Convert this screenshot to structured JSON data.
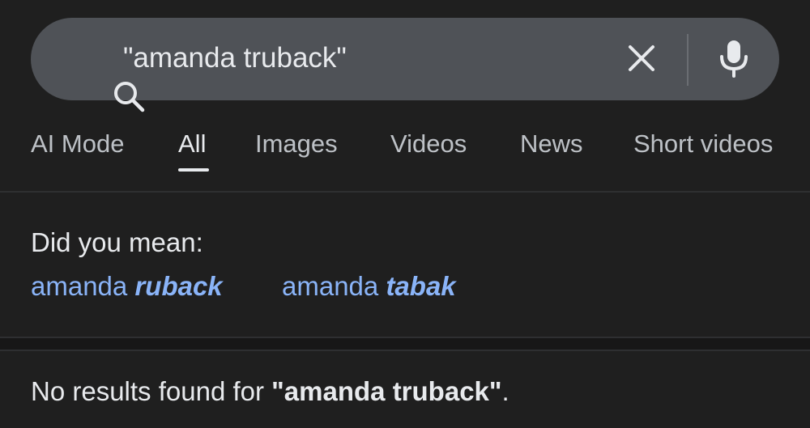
{
  "search": {
    "query": "\"amanda truback\"",
    "search_icon": "search-icon",
    "clear_icon": "close-icon",
    "mic_icon": "microphone-icon"
  },
  "tabs": [
    {
      "label": "AI Mode",
      "active": false
    },
    {
      "label": "All",
      "active": true
    },
    {
      "label": "Images",
      "active": false
    },
    {
      "label": "Videos",
      "active": false
    },
    {
      "label": "News",
      "active": false
    },
    {
      "label": "Short videos",
      "active": false
    }
  ],
  "did_you_mean": {
    "label": "Did you mean:",
    "suggestions": [
      {
        "prefix": "amanda ",
        "emphasis": "ruback"
      },
      {
        "prefix": "amanda ",
        "emphasis": "tabak"
      }
    ]
  },
  "no_results": {
    "prefix": "No results found for ",
    "query": "\"amanda truback\"",
    "suffix": "."
  },
  "colors": {
    "background": "#1f1f1f",
    "search_bar": "#4f5257",
    "link": "#8ab4f8",
    "text": "#e8eaed",
    "muted_text": "#bdc1c6"
  }
}
